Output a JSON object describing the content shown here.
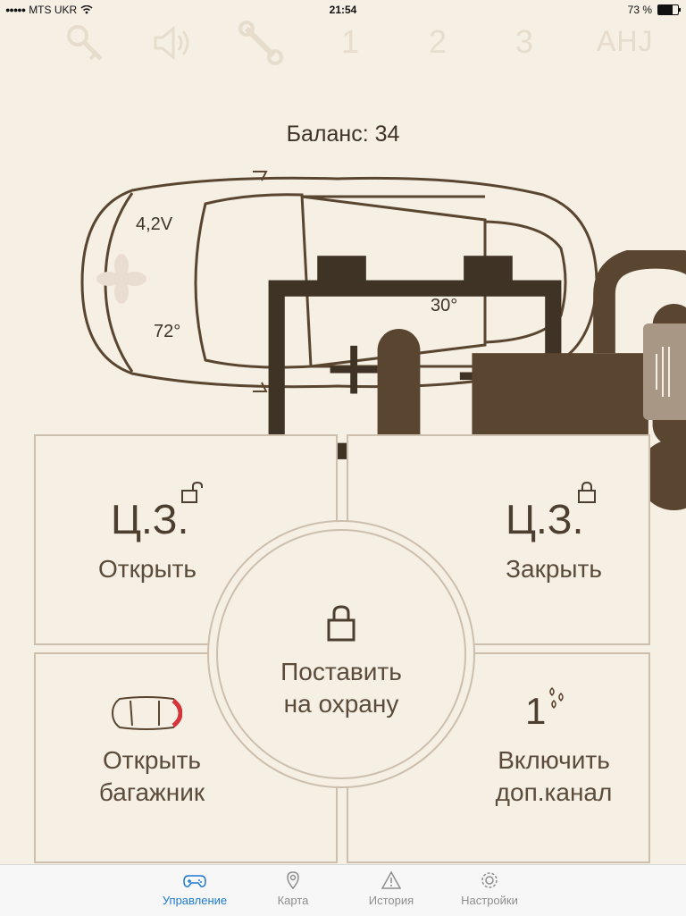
{
  "status_bar": {
    "carrier": "MTS UKR",
    "time": "21:54",
    "battery_text": "73 %",
    "battery_level": 0.73
  },
  "top_icons": [
    {
      "icon": "key-icon"
    },
    {
      "icon": "speaker-icon"
    },
    {
      "icon": "wrench-icon"
    },
    {
      "icon": "channel-1-icon",
      "label": "1"
    },
    {
      "icon": "channel-2-icon",
      "label": "2"
    },
    {
      "icon": "channel-3-icon",
      "label": "3"
    },
    {
      "icon": "ahj-icon",
      "label": "AHJ"
    }
  ],
  "balance": "Баланс: 34",
  "car_status": {
    "battery_voltage": "4,2V",
    "engine_temp": "72°",
    "cabin_temp": "30°",
    "lock_state_icon": "unlocked-padlock-icon"
  },
  "controls": {
    "open_lock": {
      "title": "Ц.З.",
      "label": "Открыть",
      "icon": "unlocked-icon"
    },
    "close_lock": {
      "title": "Ц.З.",
      "label": "Закрыть",
      "icon": "locked-icon"
    },
    "arm": {
      "label_line1": "Поставить",
      "label_line2": "на охрану",
      "icon": "lock-icon"
    },
    "trunk": {
      "label_line1": "Открыть",
      "label_line2": "багажник",
      "icon": "car-trunk-icon"
    },
    "aux_channel": {
      "label_line1": "Включить",
      "label_line2": "доп.канал",
      "icon": "channel-1-icon",
      "number": "1"
    }
  },
  "tabs": [
    {
      "label": "Управление",
      "icon": "gamepad-icon",
      "active": true
    },
    {
      "label": "Карта",
      "icon": "map-pin-icon",
      "active": false
    },
    {
      "label": "История",
      "icon": "warning-icon",
      "active": false
    },
    {
      "label": "Настройки",
      "icon": "gear-icon",
      "active": false
    }
  ],
  "colors": {
    "background": "#f6efe4",
    "accent_brown": "#5a4630",
    "active_tab": "#1e7ad1",
    "trunk_highlight": "#d6333a"
  }
}
